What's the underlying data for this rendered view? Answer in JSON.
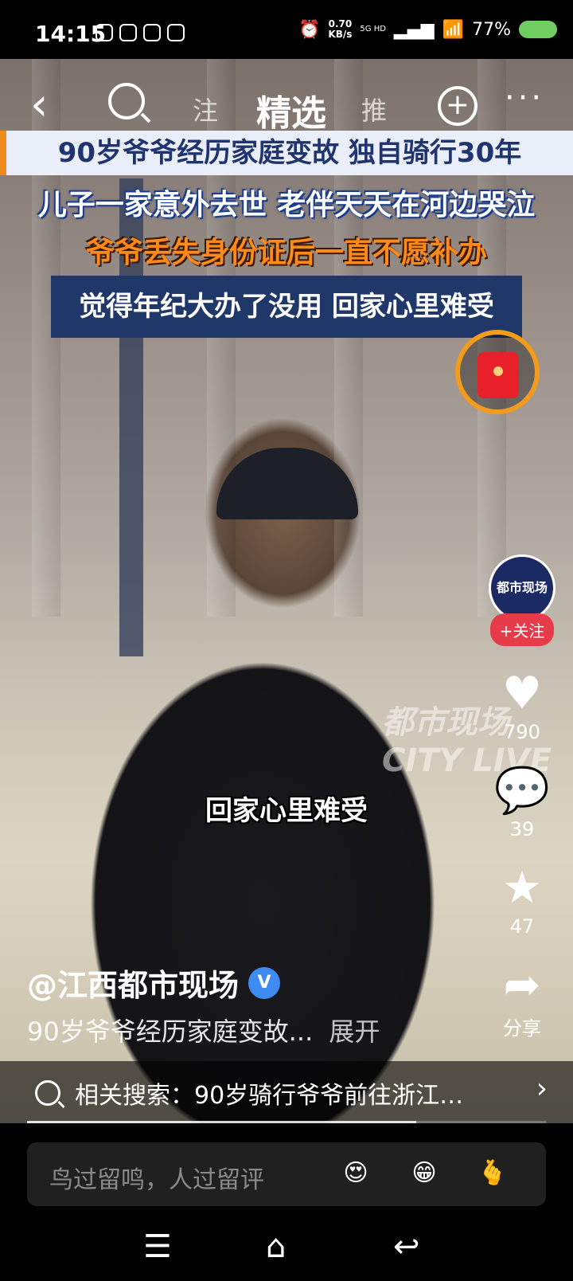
{
  "status_bar": {
    "time": "14:15",
    "net_speed_value": "0.70",
    "net_speed_unit": "KB/s",
    "signal_label": "5G HD",
    "battery": "77%"
  },
  "top_nav": {
    "tab_left": "注",
    "tab_active": "精选",
    "tab_right": "推"
  },
  "video": {
    "headline_1": "90岁爷爷经历家庭变故 独自骑行30年",
    "headline_2": "儿子一家意外去世 老伴天天在河边哭泣",
    "headline_3": "爷爷丢失身份证后一直不愿补办",
    "headline_4": "觉得年纪大办了没用 回家心里难受",
    "subtitle": "回家心里难受",
    "watermark": "都市现场 CITY LIVE",
    "avatar_text": "都市现场",
    "progress": 0.75
  },
  "actions": {
    "follow_label": "+关注",
    "likes": "790",
    "comments": "39",
    "favorites": "47",
    "share_label": "分享"
  },
  "author": {
    "name": "@江西都市现场",
    "verified_badge": "V",
    "description": "90岁爷爷经历家庭变故...",
    "expand_label": "展开"
  },
  "related_search": {
    "text": "相关搜索：90岁骑行爷爷前往浙江…"
  },
  "comment_bar": {
    "placeholder": "鸟过留鸣，人过留评"
  },
  "colors": {
    "follow_red": "#e63c4a",
    "verified_blue": "#3f8bf4",
    "headline_navy": "#1f3769",
    "accent_orange": "#f29b1d"
  }
}
